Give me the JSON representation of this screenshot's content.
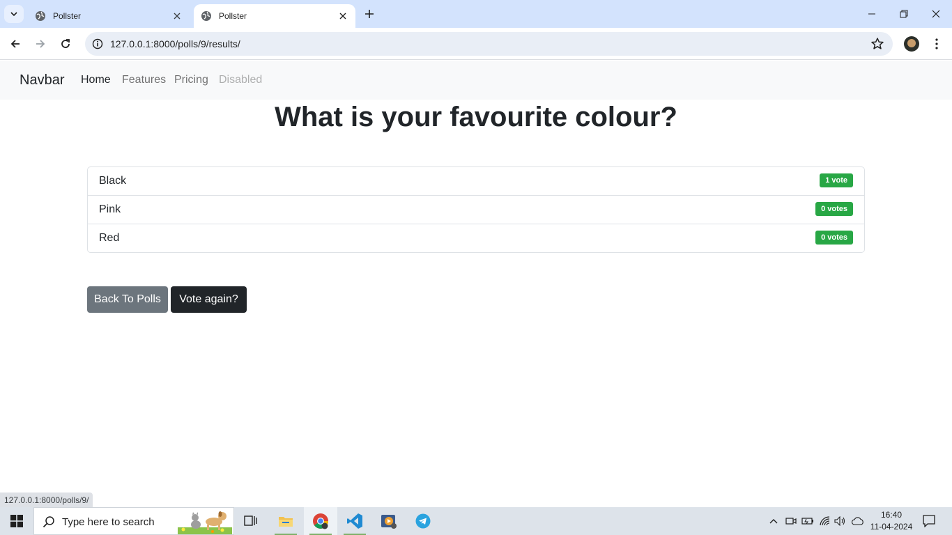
{
  "browser": {
    "tabs": [
      {
        "title": "Pollster",
        "active": false
      },
      {
        "title": "Pollster",
        "active": true
      }
    ],
    "url": "127.0.0.1:8000/polls/9/results/",
    "status_url": "127.0.0.1:8000/polls/9/"
  },
  "navbar": {
    "brand": "Navbar",
    "links": [
      {
        "label": "Home",
        "state": "active"
      },
      {
        "label": "Features",
        "state": "normal"
      },
      {
        "label": "Pricing",
        "state": "normal"
      },
      {
        "label": "Disabled",
        "state": "disabled"
      }
    ]
  },
  "poll": {
    "question": "What is your favourite colour?",
    "choices": [
      {
        "label": "Black",
        "votes": "1 vote"
      },
      {
        "label": "Pink",
        "votes": "0 votes"
      },
      {
        "label": "Red",
        "votes": "0 votes"
      }
    ],
    "back_label": "Back To Polls",
    "vote_again_label": "Vote again?"
  },
  "colors": {
    "badge": "#28a745",
    "back_button": "#6c757d",
    "vote_button": "#212529",
    "tab_strip": "#d3e3fd"
  },
  "taskbar": {
    "search_placeholder": "Type here to search",
    "apps": [
      "task-view",
      "file-explorer",
      "chrome",
      "vs-code",
      "media-player",
      "telegram"
    ],
    "time": "16:40",
    "date": "11-04-2024"
  }
}
